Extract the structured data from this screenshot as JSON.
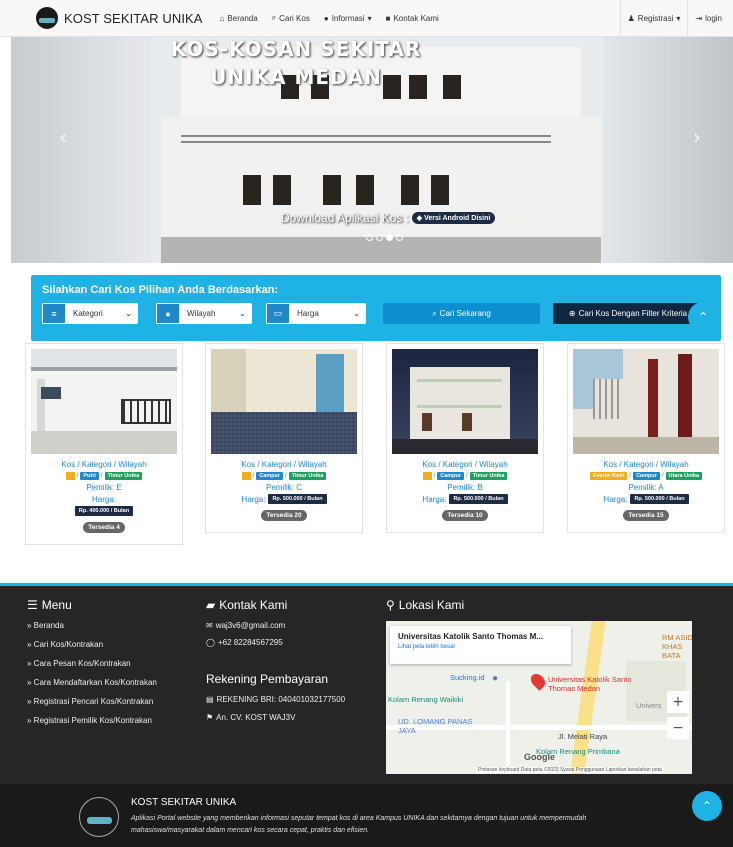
{
  "navbar": {
    "brand": "KOST SEKITAR UNIKA",
    "links": [
      {
        "label": "Beranda",
        "icon": "home-icon"
      },
      {
        "label": "Cari Kos",
        "icon": "search-icon"
      },
      {
        "label": "Informasi",
        "icon": "info-icon"
      },
      {
        "label": "Kontak Kami",
        "icon": "phone-icon"
      }
    ],
    "right": [
      {
        "label": "Registrasi",
        "icon": "users-icon"
      },
      {
        "label": "login",
        "icon": "login-icon"
      }
    ]
  },
  "hero": {
    "title_line1": "KOS-KOSAN SEKITAR",
    "title_line2": "UNIKA MEDAN",
    "caption": "Download Aplikasi Kos",
    "caption_badge": "Versi Android Disini"
  },
  "search": {
    "title": "Silahkan Cari Kos Pilihan Anda Berdasarkan:",
    "selects": [
      {
        "value": "Kategori",
        "icon": "list-icon"
      },
      {
        "value": "Wilayah",
        "icon": "pin-icon"
      },
      {
        "value": "Harga",
        "icon": "money-icon"
      }
    ],
    "search_button": "Cari Sekarang",
    "filter_button": "Cari Kos Dengan Filter Kriteria"
  },
  "cards": [
    {
      "category": "Kos / Kategori / Wilayah",
      "tag1": "",
      "tag2": "Putri",
      "tag3": "Timur Unika",
      "owner": "Pemilik: E",
      "price_label": "Harga:",
      "price": "Rp. 400.000 / Bulan",
      "available": "Tersedia 4"
    },
    {
      "category": "Kos / Kategori / Wilayah",
      "tag1": "",
      "tag2": "Campur",
      "tag3": "Timur Unika",
      "owner": "Pemilik: C",
      "price_label": "Harga:",
      "price": "Rp. 500.000 / Bulan",
      "available": "Tersedia 20"
    },
    {
      "category": "Kos / Kategori / Wilayah",
      "tag1": "",
      "tag2": "Campur",
      "tag3": "Timur Unika",
      "owner": "Pemilik: B",
      "price_label": "Harga:",
      "price": "Rp. 500.000 / Bulan",
      "available": "Tersedia 10"
    },
    {
      "category": "Kos / Kategori / Wilayah",
      "tag1": "Evelyn Kost",
      "tag2": "Campur",
      "tag3": "Utara Unika",
      "owner": "Pemilik: A",
      "price_label": "Harga:",
      "price": "Rp. 500.000 / Bulan",
      "available": "Tersedia 15"
    }
  ],
  "footer": {
    "menu_title": "Menu",
    "menu_items": [
      "Beranda",
      "Cari Kos/Kontrakan",
      "Cara Pesan Kos/Kontrakan",
      "Cara Mendaftarkan Kos/Kontrakan",
      "Registrasi Pencari Kos/Kontrakan",
      "Registrasi Pemilik Kos/Kontrakan"
    ],
    "contact_title": "Kontak Kami",
    "email": "waj3v6@gmail.com",
    "phone": "+62 82284567295",
    "payment_title": "Rekening Pembayaran",
    "account": "REKENING BRI: 040401032177500",
    "account_name": "An. CV. KOST WAJ3V",
    "location_title": "Lokasi Kami",
    "map": {
      "place_title": "Universitas Katolik Santo Thomas M...",
      "place_link": "Lihat peta lebih besar",
      "label_pin": "Universitas Katolik Santo Thomas Medan",
      "label_sucking": "Sucking.id",
      "label_pool": "Kolam Renang Waikiki",
      "label_lomang": "UD. LOMANG PANAS JAYA",
      "label_road": "Jl. Melati Raya",
      "label_primbana": "Kolam Renang Primbana",
      "label_rm": "RM ASID KHAS BATA",
      "label_univ": "Univers",
      "label_google": "Google",
      "attribution": "Pintasan keyboard   Data peta ©2023   Syarat Penggunaan   Laporkan kesalahan peta"
    }
  },
  "bottom": {
    "title": "KOST SEKITAR UNIKA",
    "description": "Aplikasi Portal website yang memberikan informasi seputar tempat kos di area Kampus UNIKA dan sekitarnya dengan tujuan untuk mempermudah mahasiswa/masyarakat dalam mencari kos secara cepat, praktis dan efisien."
  },
  "colors": {
    "accent": "#1fb3e5",
    "navy": "#1f2a44",
    "footer_bg": "#262626"
  }
}
